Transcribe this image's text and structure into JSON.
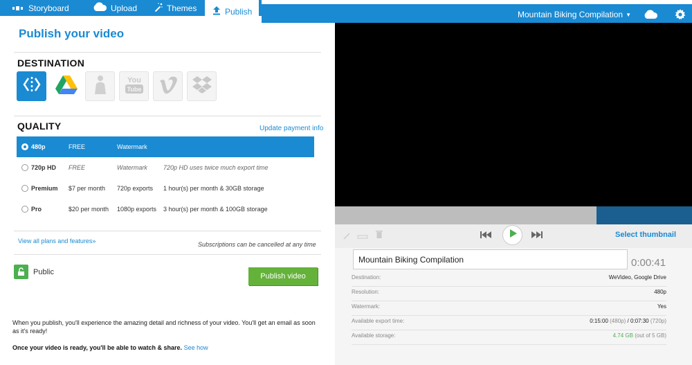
{
  "tabs": {
    "storyboard": "Storyboard",
    "upload": "Upload",
    "themes": "Themes",
    "publish": "Publish"
  },
  "project": {
    "title": "Mountain Biking Compilation"
  },
  "colors": {
    "accent": "#1a8ad2",
    "publish_button": "#64b23a",
    "storage_used": "#4caf50"
  },
  "page": {
    "title": "Publish your video"
  },
  "destination": {
    "heading": "DESTINATION",
    "items": [
      {
        "name": "WeVideo",
        "icon": "wevideo-icon",
        "state": "selected"
      },
      {
        "name": "Google Drive",
        "icon": "google-drive-icon",
        "state": "available"
      },
      {
        "name": "Facebook",
        "icon": "person-icon",
        "state": "disabled"
      },
      {
        "name": "YouTube",
        "icon": "youtube-icon",
        "state": "disabled"
      },
      {
        "name": "Vimeo",
        "icon": "vimeo-icon",
        "state": "disabled"
      },
      {
        "name": "Dropbox",
        "icon": "dropbox-icon",
        "state": "disabled"
      }
    ]
  },
  "quality": {
    "heading": "QUALITY",
    "update_link": "Update payment info",
    "plans": [
      {
        "name": "480p",
        "price": "FREE",
        "feature": "Watermark",
        "desc": ""
      },
      {
        "name": "720p HD",
        "price": "FREE",
        "feature": "Watermark",
        "desc": "720p HD uses twice much export time"
      },
      {
        "name": "Premium",
        "price": "$7 per month",
        "feature": "720p exports",
        "desc": "1 hour(s) per month & 30GB storage"
      },
      {
        "name": "Pro",
        "price": "$20 per month",
        "feature": "1080p exports",
        "desc": "3 hour(s) per month & 100GB storage"
      }
    ],
    "view_all": "View all plans and features»",
    "cancel_note": "Subscriptions can be cancelled at any time"
  },
  "privacy": {
    "label": "Public"
  },
  "publish_button": "Publish video",
  "info": {
    "line1": "When you publish, you'll experience the amazing detail and richness of your video. You'll get an email as soon as it's ready!",
    "line2": "Once your video is ready, you'll be able to watch & share.",
    "see_how": "See how"
  },
  "player": {
    "select_thumbnail": "Select thumbnail",
    "title_value": "Mountain Biking Compilation",
    "duration": "0:00:41"
  },
  "details": [
    {
      "label": "Destination:",
      "value": "WeVideo, Google Drive"
    },
    {
      "label": "Resolution:",
      "value": "480p"
    },
    {
      "label": "Watermark:",
      "value": "Yes"
    }
  ],
  "export_time": {
    "label": "Available export time:",
    "a": "0:15:00",
    "a_note": "(480p)",
    "sep": " / ",
    "b": "0:07:30",
    "b_note": "(720p)"
  },
  "storage": {
    "label": "Available storage:",
    "used": "4.74 GB",
    "total": "(out of 5 GB)"
  }
}
